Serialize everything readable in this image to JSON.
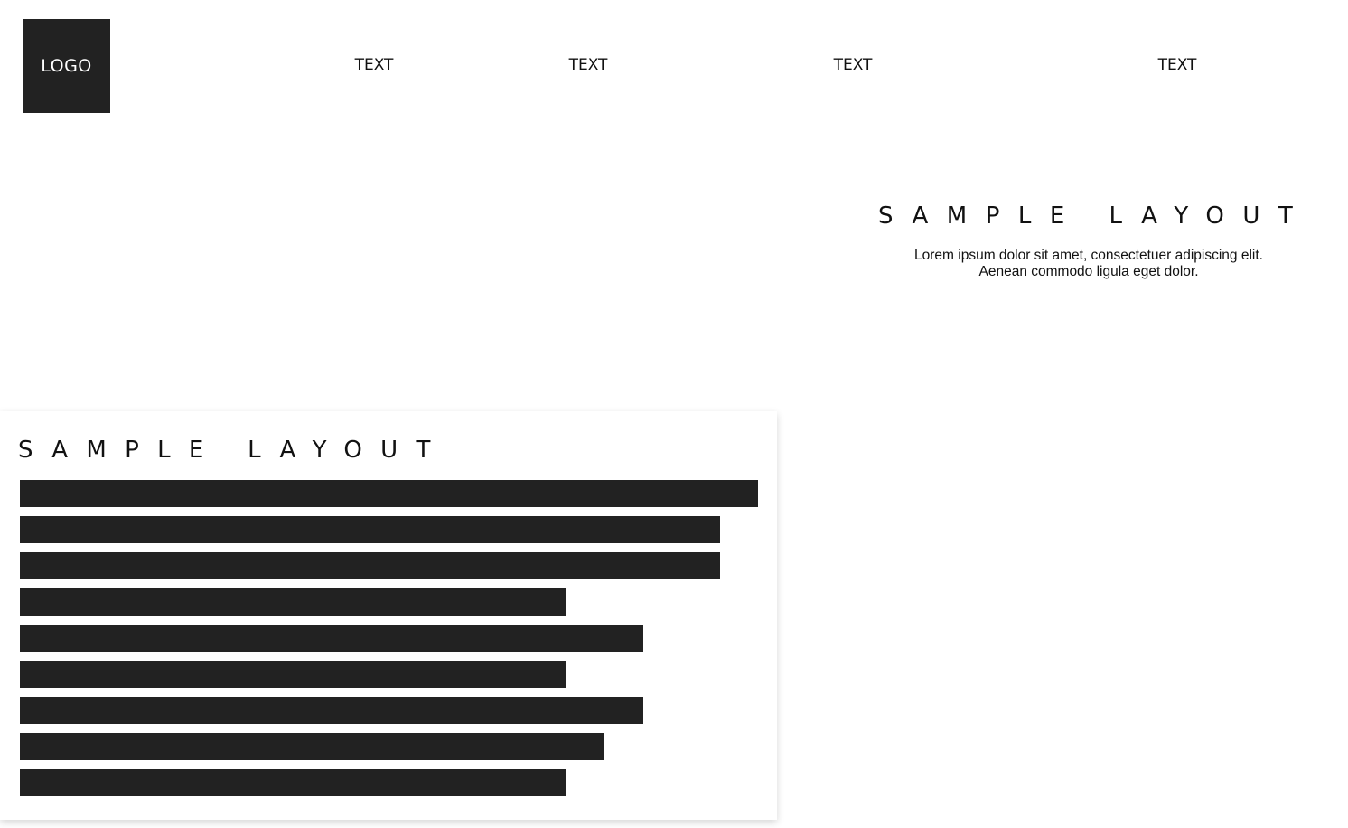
{
  "header": {
    "logo": "LOGO",
    "nav": [
      "TEXT",
      "TEXT",
      "TEXT",
      "TEXT"
    ]
  },
  "hero": {
    "title": "SAMPLE LAYOUT",
    "description_line1": "Lorem ipsum dolor sit amet, consectetuer adipiscing elit.",
    "description_line2": "Aenean commodo ligula eget dolor."
  },
  "card": {
    "title": "SAMPLE LAYOUT",
    "placeholder_line_count": 9,
    "placeholder_line_fill": [
      1.0,
      0.948,
      0.948,
      0.74,
      0.844,
      0.74,
      0.844,
      0.792,
      0.74
    ]
  },
  "colors": {
    "dark": "#222222",
    "background": "#ffffff"
  }
}
